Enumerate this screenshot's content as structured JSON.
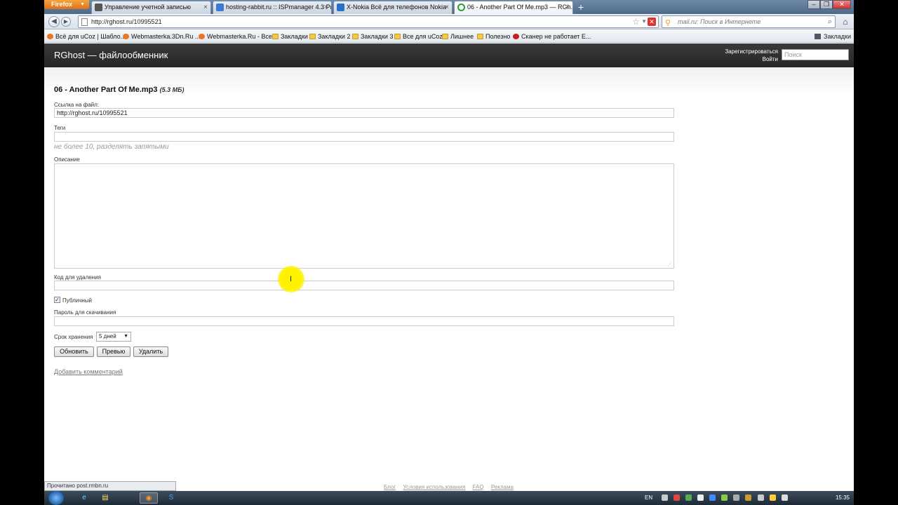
{
  "browser": {
    "menu_label": "Firefox",
    "tabs": [
      {
        "label": "Управление учетной записью",
        "color": "#555"
      },
      {
        "label": "hosting-rabbit.ru :: ISPmanager 4.3 Pr...",
        "color": "#3a7bd5"
      },
      {
        "label": "X-Nokia Всё для телефонов Nokia",
        "color": "#2a6fc9"
      },
      {
        "label": "06 - Another Part Of Me.mp3 — RGh...",
        "color": "#2a9d3a"
      }
    ],
    "url": "http://rghost.ru/10995521",
    "search_placeholder": "mail.ru: Поиск в Интернете",
    "bookmarks": [
      "Всё для uCoz | Шабло...",
      "Webmasterka.3Dn.Ru ...",
      "Webmasterka.Ru - Все...",
      "Закладки",
      "Закладки 2",
      "Закладки 3",
      "Все для uCoz",
      "Лишнее",
      "Полезно",
      "Сканер не работает E..."
    ],
    "bookmarks_menu": "Закладки",
    "status": "Прочитано post.rmbn.ru"
  },
  "site": {
    "title": "RGhost — файлообменник",
    "register": "Зарегистрироваться",
    "login": "Войти",
    "search_placeholder": "Поиск"
  },
  "form": {
    "file_name": "06 - Another Part Of Me.mp3",
    "file_size": "(5.3 МБ)",
    "link_label": "Ссылка на файл:",
    "link_value": "http://rghost.ru/10995521",
    "tags_label": "Теги",
    "tags_hint": "не более 10, разделять запятыми",
    "description_label": "Описание",
    "delete_code_label": "Код для удаления",
    "public_label": "Публичный",
    "public_checked": true,
    "password_label": "Пароль для скачивания",
    "storage_label": "Срок хранения",
    "storage_value": "5 дней",
    "btn_update": "Обновить",
    "btn_preview": "Превью",
    "btn_delete": "Удалить",
    "add_comment": "Добавить комментарий"
  },
  "footer": {
    "links": [
      "Блог",
      "Условия использования",
      "FAQ",
      "Реклама"
    ]
  },
  "taskbar": {
    "lang": "EN",
    "time": "15:35"
  }
}
